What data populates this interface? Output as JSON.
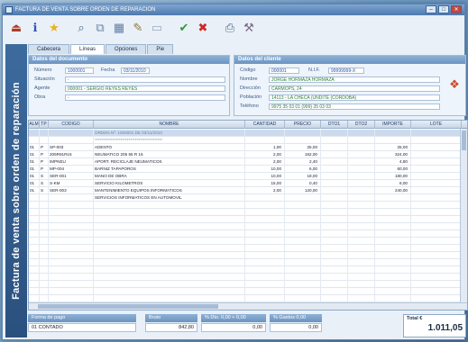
{
  "window": {
    "title": "FACTURA DE VENTA SOBRE ORDEN DE REPARACION",
    "buttons": {
      "minimize": "–",
      "maximize": "□",
      "close": "✕"
    }
  },
  "toolbar": [
    {
      "name": "exit-icon",
      "glyph": "⏏",
      "color": "#b23a2a"
    },
    {
      "name": "info-icon",
      "glyph": "ℹ",
      "color": "#2a56b0"
    },
    {
      "name": "star-icon",
      "glyph": "★",
      "color": "#e7b21c"
    },
    {
      "name": "search-icon",
      "glyph": "⌕",
      "color": "#4a6c8f"
    },
    {
      "name": "copy-icon",
      "glyph": "⧉",
      "color": "#6b86a6"
    },
    {
      "name": "grid-icon",
      "glyph": "▦",
      "color": "#5f7fa2"
    },
    {
      "name": "edit-icon",
      "glyph": "✎",
      "color": "#8c7a44"
    },
    {
      "name": "page-icon",
      "glyph": "▭",
      "color": "#9aa9bc"
    },
    {
      "name": "confirm-icon",
      "glyph": "✔",
      "color": "#2f9a35"
    },
    {
      "name": "cancel-icon",
      "glyph": "✖",
      "color": "#c92a24"
    },
    {
      "name": "print-icon",
      "glyph": "⎙",
      "color": "#4d6b91"
    },
    {
      "name": "tools-icon",
      "glyph": "⚒",
      "color": "#7d6c8a"
    }
  ],
  "banner": "Factura de venta sobre orden de reparación",
  "tabs": [
    "Cabecera",
    "Líneas",
    "Opciones",
    "Pie"
  ],
  "active_tab": 1,
  "document": {
    "header": "Datos del documento",
    "numero_label": "Número",
    "numero": "1000001",
    "fecha_label": "Fecha",
    "fecha": "03/11/2010",
    "situacion_label": "Situación",
    "situacion": "-",
    "agente_label": "Agente",
    "agente": "000001 - SERGIO REYES REYES",
    "obra_label": "Obra",
    "obra": "-"
  },
  "client": {
    "header": "Datos del cliente",
    "codigo_label": "Código",
    "codigo": "000001",
    "nif_label": "N.I.F.",
    "nif": "99999999-X",
    "nombre_label": "Nombre",
    "nombre": "JORGE HORMAZA HORMAZA",
    "direccion_label": "Dirección",
    "direccion": "CARMOPS, 24",
    "poblacion_label": "Población",
    "poblacion": "14113 - LA CHECA (UNDITE (CORDOBA)",
    "telefono_label": "Teléfono",
    "telefono": "9975 35 03 01   (999) 35 03 03"
  },
  "grid": {
    "columns": [
      "ALM",
      "TP",
      "CODIGO",
      "NOMBRE",
      "CANTIDAD",
      "PRECIO",
      "DTO1",
      "DTO2",
      "IMPORTE",
      "LOTE"
    ],
    "rows": [
      {
        "alm": "",
        "tp": "",
        "codigo": "",
        "nombre": "ORDEN Nº: 1000001 DE 03/11/2010",
        "cantidad": "",
        "precio": "",
        "dto1": "",
        "dto2": "",
        "importe": "",
        "lote": "",
        "style": "sel"
      },
      {
        "alm": "",
        "tp": "",
        "codigo": "",
        "nombre": "******************************************",
        "cantidad": "",
        "precio": "",
        "dto1": "",
        "dto2": "",
        "importe": "",
        "lote": "",
        "style": "grey"
      },
      {
        "alm": "01",
        "tp": "P",
        "codigo": "SP-003",
        "nombre": "ADENTO",
        "cantidad": "1,00",
        "precio": "25,00",
        "dto1": "",
        "dto2": "",
        "importe": "25,00",
        "lote": ""
      },
      {
        "alm": "01",
        "tp": "P",
        "codigo": "205R91R16",
        "nombre": "NEUMATICO 205 55 R 16",
        "cantidad": "2,00",
        "precio": "162,00",
        "dto1": "",
        "dto2": "",
        "importe": "324,00",
        "lote": ""
      },
      {
        "alm": "01",
        "tp": "P",
        "codigo": "IMPNEU",
        "nombre": "APORT. RECICLAJE NEUMATICOS",
        "cantidad": "2,00",
        "precio": "2,40",
        "dto1": "",
        "dto2": "",
        "importe": "4,80",
        "lote": ""
      },
      {
        "alm": "01",
        "tp": "P",
        "codigo": "MP-004",
        "nombre": "BARNIZ TAPAPOROS",
        "cantidad": "10,00",
        "precio": "6,00",
        "dto1": "",
        "dto2": "",
        "importe": "60,00",
        "lote": ""
      },
      {
        "alm": "01",
        "tp": "S",
        "codigo": "SER-001",
        "nombre": "MANO DE OBRA",
        "cantidad": "10,00",
        "precio": "18,00",
        "dto1": "",
        "dto2": "",
        "importe": "180,00",
        "lote": ""
      },
      {
        "alm": "01",
        "tp": "S",
        "codigo": "S-KM",
        "nombre": "SERVICIO KILOMETROS",
        "cantidad": "15,00",
        "precio": "0,40",
        "dto1": "",
        "dto2": "",
        "importe": "6,00",
        "lote": ""
      },
      {
        "alm": "01",
        "tp": "S",
        "codigo": "SER-003",
        "nombre": "MANTENIMIENTO EQUIPOS INFORMATICOS",
        "cantidad": "2,00",
        "precio": "120,00",
        "dto1": "",
        "dto2": "",
        "importe": "240,00",
        "lote": ""
      },
      {
        "alm": "",
        "tp": "",
        "codigo": "",
        "nombre": "SERVICIOS INFORMATICOS EN AUTOMOVIL",
        "cantidad": "",
        "precio": "",
        "dto1": "",
        "dto2": "",
        "importe": "",
        "lote": ""
      }
    ],
    "empty_rows": 14
  },
  "footer": {
    "forma_pago_label": "Forma de pago",
    "forma_pago": "01  CONTADO",
    "bruto_label": "Bruto",
    "bruto": "842,80",
    "dto_label": "% Dto.  0,00 + 0,00",
    "dto": "0,00",
    "gastos_label": "% Gastos  0,00",
    "gastos": "0,00",
    "total_label": "Total €",
    "total": "1.011,05"
  },
  "colors": {
    "header_blue": "#6b93c0",
    "value_green": "#2f7a37",
    "window_bg": "#e9f0f8"
  }
}
